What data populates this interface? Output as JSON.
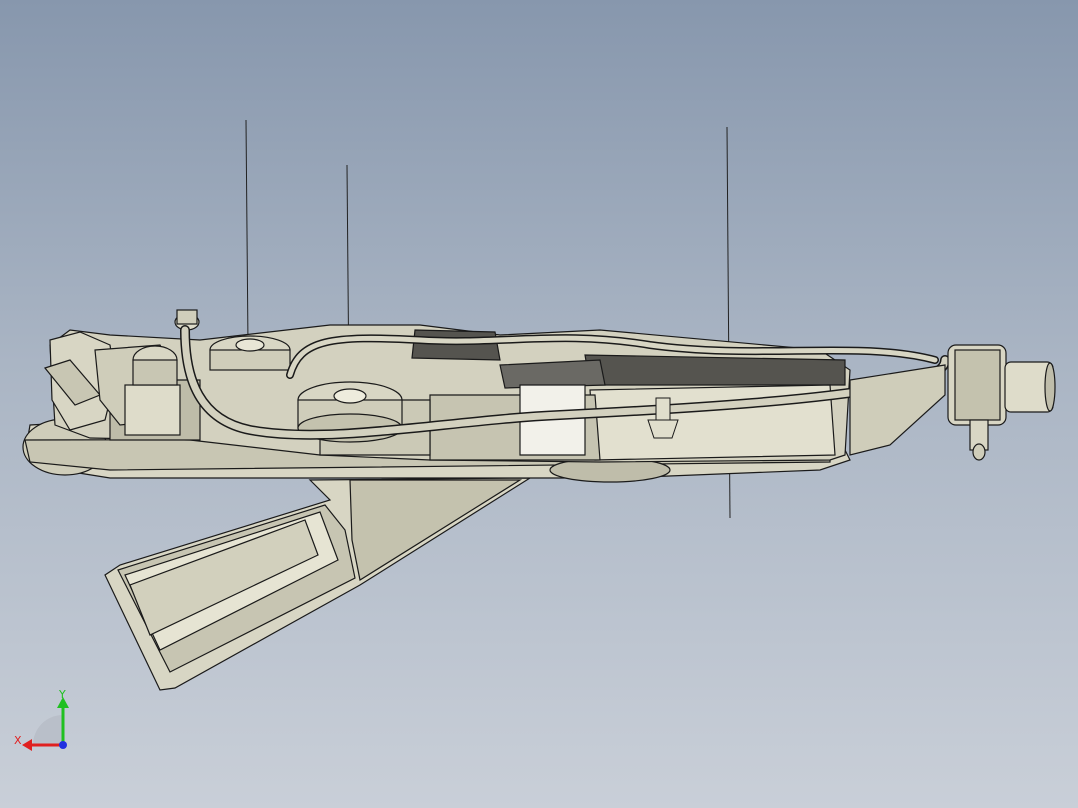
{
  "viewport": {
    "background_top": "#8797ad",
    "background_bottom": "#c9cfd8"
  },
  "model": {
    "body_color": "#d8d6c4",
    "shade_color": "#a9a795",
    "dark_color": "#5a5a56",
    "edge_color": "#1a1a1a"
  },
  "triad": {
    "x_label": "X",
    "y_label": "Y",
    "x_color": "#e02020",
    "y_color": "#20c020",
    "z_color": "#2030e0"
  }
}
